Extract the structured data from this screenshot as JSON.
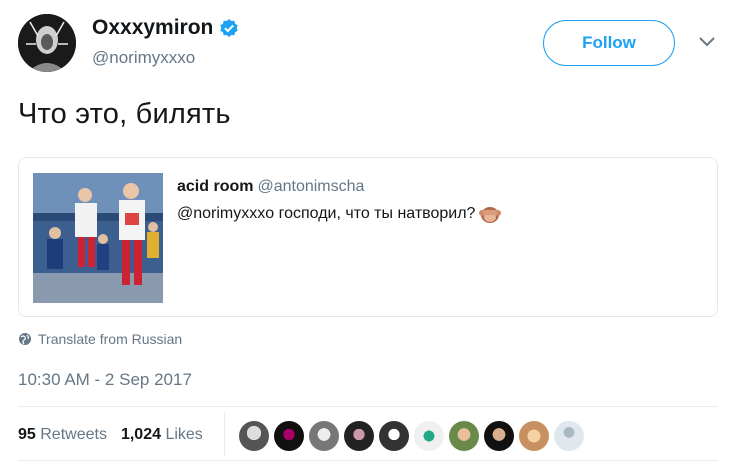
{
  "author": {
    "name": "Oxxxymiron",
    "handle": "@norimyxxxo",
    "verified_icon": "verified-badge-icon",
    "accent": "#1da1f2"
  },
  "follow_label": "Follow",
  "tweet_text": "Что это, билять",
  "quote": {
    "name": "acid room",
    "handle": "@antonimscha",
    "text": "@norimyxxxo господи, что ты натворил?",
    "emoji": "see-no-evil-monkey-icon"
  },
  "translate_label": "Translate from Russian",
  "timestamp": "10:30 AM - 2 Sep 2017",
  "stats": {
    "retweets_count": "95",
    "retweets_label": "Retweets",
    "likes_count": "1,024",
    "likes_label": "Likes"
  },
  "liker_avatars": [
    "a1",
    "a2",
    "a3",
    "a4",
    "a5",
    "a6",
    "a7",
    "a8",
    "a9",
    "a10"
  ]
}
